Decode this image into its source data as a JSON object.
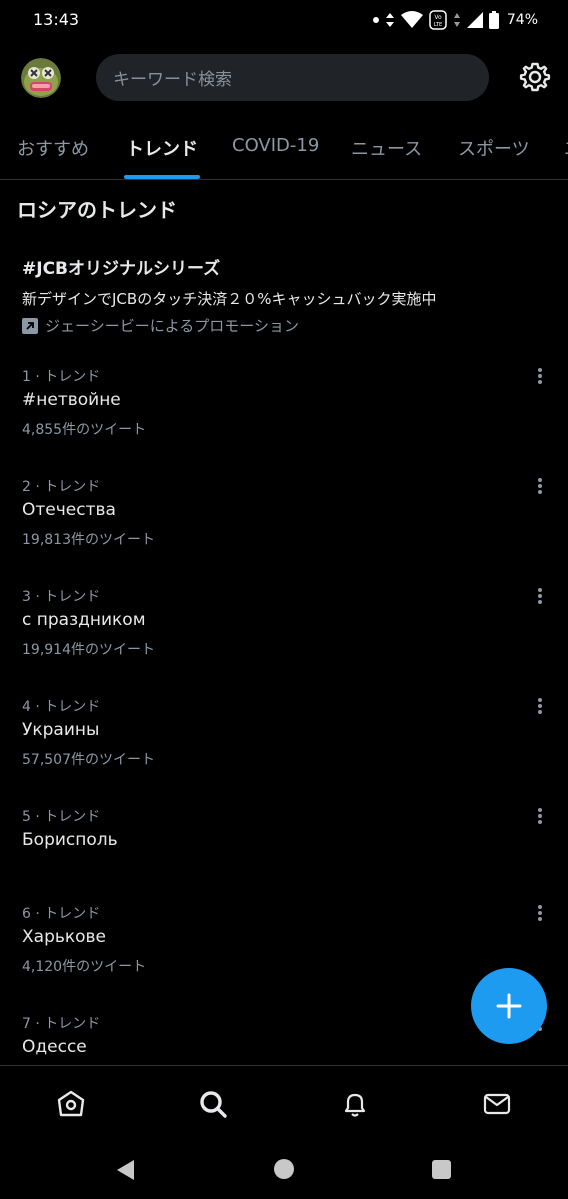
{
  "status": {
    "time": "13:43",
    "battery": "74%"
  },
  "header": {
    "search_placeholder": "キーワード検索"
  },
  "tabs": [
    {
      "label": "おすすめ"
    },
    {
      "label": "トレンド"
    },
    {
      "label": "COVID-19"
    },
    {
      "label": "ニュース"
    },
    {
      "label": "スポーツ"
    },
    {
      "label": "エ"
    }
  ],
  "section": {
    "title": "ロシアのトレンド"
  },
  "promo": {
    "title": "#JCBオリジナルシリーズ",
    "description": "新デザインでJCBのタッチ決済２０%キャッシュバック実施中",
    "promoted_by": "ジェーシービーによるプロモーション"
  },
  "trends": [
    {
      "meta": "1 · トレンド",
      "name": "#нетвойне",
      "count": "4,855件のツイート"
    },
    {
      "meta": "2 · トレンド",
      "name": "Отечества",
      "count": "19,813件のツイート"
    },
    {
      "meta": "3 · トレンド",
      "name": "с праздником",
      "count": "19,914件のツイート"
    },
    {
      "meta": "4 · トレンド",
      "name": "Украины",
      "count": "57,507件のツイート"
    },
    {
      "meta": "5 · トレンド",
      "name": "Борисполь",
      "count": ""
    },
    {
      "meta": "6 · トレンド",
      "name": "Харькове",
      "count": "4,120件のツイート"
    },
    {
      "meta": "7 · トレンド",
      "name": "Одессе",
      "count": ""
    }
  ],
  "icons": {
    "accent": "#1d9bf0"
  }
}
